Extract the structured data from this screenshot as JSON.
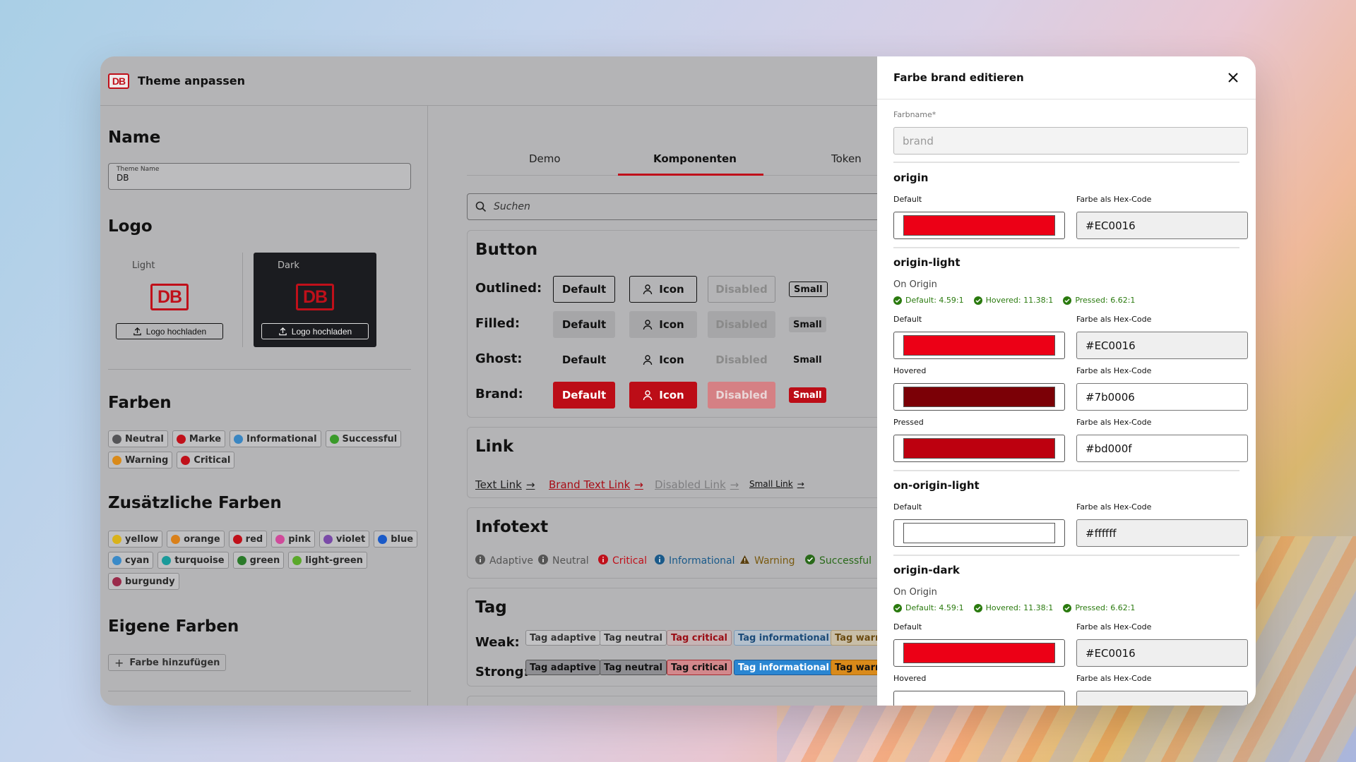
{
  "app": {
    "logo_text": "DB",
    "title": "Theme anpassen"
  },
  "left": {
    "name_heading": "Name",
    "theme_name_label": "Theme Name",
    "theme_name_value": "DB",
    "logo_heading": "Logo",
    "logo_light_caption": "Light",
    "logo_dark_caption": "Dark",
    "upload_label": "Logo hochladen",
    "colors_heading": "Farben",
    "colors": [
      {
        "label": "Neutral",
        "color": "#555558"
      },
      {
        "label": "Marke",
        "color": "#c0101a"
      },
      {
        "label": "Informational",
        "color": "#3a86c2"
      },
      {
        "label": "Successful",
        "color": "#3a9a2a"
      },
      {
        "label": "Warning",
        "color": "#d98a1a"
      },
      {
        "label": "Critical",
        "color": "#c0101a"
      }
    ],
    "extra_heading": "Zusätzliche Farben",
    "extra_colors": [
      {
        "label": "yellow",
        "color": "#d9b21a"
      },
      {
        "label": "orange",
        "color": "#d9801a"
      },
      {
        "label": "red",
        "color": "#c0101a"
      },
      {
        "label": "pink",
        "color": "#d04a9a"
      },
      {
        "label": "violet",
        "color": "#7a4aa8"
      },
      {
        "label": "blue",
        "color": "#1a5ac8"
      },
      {
        "label": "cyan",
        "color": "#3a8ac8"
      },
      {
        "label": "turquoise",
        "color": "#1a9a9a"
      },
      {
        "label": "green",
        "color": "#2a7a2a"
      },
      {
        "label": "light-green",
        "color": "#5aa82a"
      },
      {
        "label": "burgundy",
        "color": "#9a2a4a"
      }
    ],
    "own_heading": "Eigene Farben",
    "add_color_label": "Farbe hinzufügen"
  },
  "mid": {
    "tabs": [
      "Demo",
      "Komponenten",
      "Token"
    ],
    "active_tab": "Komponenten",
    "search_placeholder": "Suchen",
    "button_card": {
      "heading": "Button",
      "rows": [
        "Outlined:",
        "Filled:",
        "Ghost:",
        "Brand:"
      ],
      "labels": {
        "default": "Default",
        "icon": "Icon",
        "disabled": "Disabled",
        "small": "Small"
      }
    },
    "link_card": {
      "heading": "Link",
      "links": [
        "Text Link",
        "Brand Text Link",
        "Disabled Link",
        "Small Link"
      ]
    },
    "infotext_card": {
      "heading": "Infotext",
      "items": [
        {
          "label": "Adaptive",
          "color": "#555"
        },
        {
          "label": "Neutral",
          "color": "#555"
        },
        {
          "label": "Critical",
          "color": "#c0101a"
        },
        {
          "label": "Informational",
          "color": "#1a5a8a"
        },
        {
          "label": "Warning",
          "color": "#7a5a10"
        },
        {
          "label": "Successful",
          "color": "#2a6a1a"
        }
      ]
    },
    "tag_card": {
      "heading": "Tag",
      "weak_label": "Weak:",
      "strong_label": "Strong:",
      "tags": [
        "Tag adaptive",
        "Tag neutral",
        "Tag critical",
        "Tag informational",
        "Tag warning"
      ]
    }
  },
  "dialog": {
    "title": "Farbe brand editieren",
    "name_label": "Farbname*",
    "name_value": "brand",
    "hex_label": "Farbe als Hex-Code",
    "default_label": "Default",
    "hovered_label": "Hovered",
    "pressed_label": "Pressed",
    "on_origin_label": "On Origin",
    "contrast": [
      "Default: 4.59:1",
      "Hovered: 11.38:1",
      "Pressed: 6.62:1"
    ],
    "origin": {
      "title": "origin",
      "default_hex": "#EC0016"
    },
    "origin_light": {
      "title": "origin-light",
      "default_hex": "#EC0016",
      "hovered_hex": "#7b0006",
      "pressed_hex": "#bd000f"
    },
    "on_origin_light": {
      "title": "on-origin-light",
      "default_hex": "#ffffff"
    },
    "origin_dark": {
      "title": "origin-dark",
      "default_hex": "#EC0016"
    }
  }
}
